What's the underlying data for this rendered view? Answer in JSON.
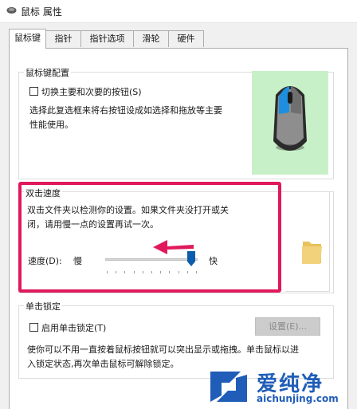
{
  "window": {
    "title": "鼠标 属性",
    "icon": "mouse-app-icon"
  },
  "tabs": [
    {
      "label": "鼠标键",
      "active": true
    },
    {
      "label": "指针",
      "active": false
    },
    {
      "label": "指针选项",
      "active": false
    },
    {
      "label": "滑轮",
      "active": false
    },
    {
      "label": "硬件",
      "active": false
    }
  ],
  "button_config": {
    "group_label": "鼠标键配置",
    "checkbox_label": "切换主要和次要的按钮(S)",
    "checked": false,
    "description_line1": "选择此复选框来将右按钮设成如选择和拖放等主要",
    "description_line2": "性能使用。"
  },
  "double_click": {
    "group_label": "双击速度",
    "description_line1": "双击文件夹以检测你的设置。如果文件夹没打开或关",
    "description_line2": "闭，请用慢一点的设置再试一次。",
    "speed_label": "速度(D):",
    "slow_label": "慢",
    "fast_label": "快",
    "speed_value_fraction": 0.95
  },
  "click_lock": {
    "group_label": "单击锁定",
    "checkbox_label": "启用单击锁定(T)",
    "checked": false,
    "settings_button": "设置(E)...",
    "description_line1": "使你可以不用一直按着鼠标按钮就可以突出显示或拖拽。单击鼠标以进",
    "description_line2": "入锁定状态,再次单击鼠标可解除锁定。"
  },
  "watermark": {
    "brand": "爱纯净",
    "url": "aichunjing.com"
  },
  "colors": {
    "highlight": "#e0195d",
    "arrow": "#e0195d",
    "mouse_panel": "#c8f0c8",
    "folder": "#f2d27a"
  }
}
